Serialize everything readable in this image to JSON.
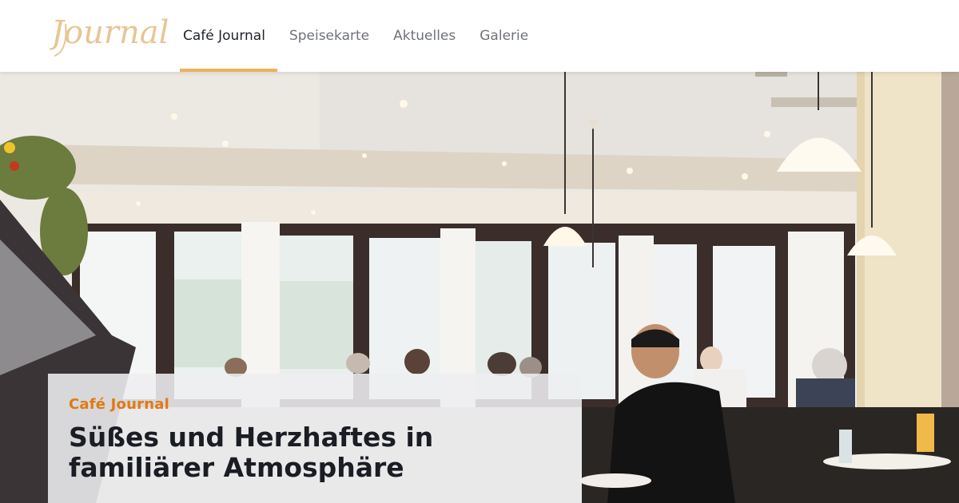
{
  "logo": {
    "text": "Journal"
  },
  "nav": {
    "items": [
      {
        "label": "Café Journal",
        "active": true
      },
      {
        "label": "Speisekarte",
        "active": false
      },
      {
        "label": "Aktuelles",
        "active": false
      },
      {
        "label": "Galerie",
        "active": false
      }
    ]
  },
  "hero": {
    "eyebrow": "Café Journal",
    "title": "Süßes und Herzhaftes in familiärer Atmosphäre"
  },
  "colors": {
    "accent": "#e07a12",
    "nav_underline": "#f0b05a",
    "logo": "#e8c595"
  }
}
